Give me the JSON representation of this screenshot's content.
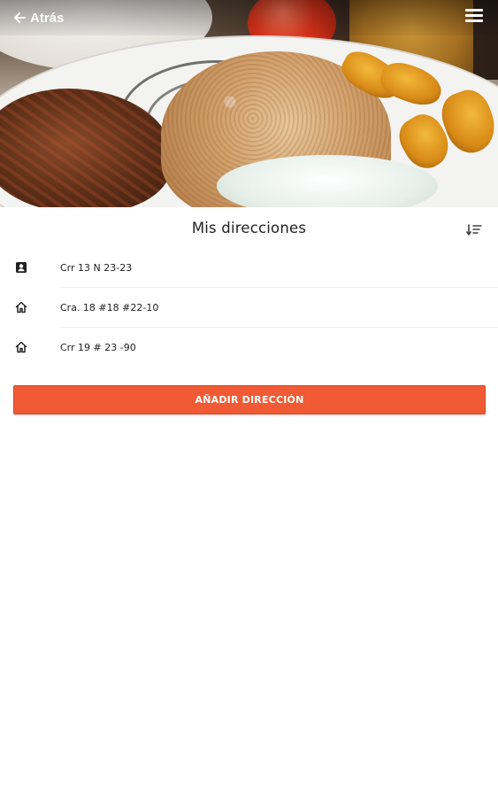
{
  "header": {
    "back_label": "Atrás",
    "icons": {
      "back": "arrow-left-icon",
      "menu": "hamburger-menu-icon",
      "sort": "sort-icon"
    }
  },
  "hero": {
    "image": "food-plate-photo"
  },
  "main": {
    "title": "Mis direcciones",
    "addresses": [
      {
        "label": "Crr 13 N 23-23",
        "icon": "person-card-icon"
      },
      {
        "label": "Cra. 18 #18 #22-10",
        "icon": "home-icon"
      },
      {
        "label": "Crr 19 # 23 -90",
        "icon": "home-icon"
      }
    ],
    "add_button_label": "AÑADIR DIRECCIÓN"
  },
  "colors": {
    "accent": "#f05a34",
    "text": "#222222",
    "divider": "#ededed"
  }
}
